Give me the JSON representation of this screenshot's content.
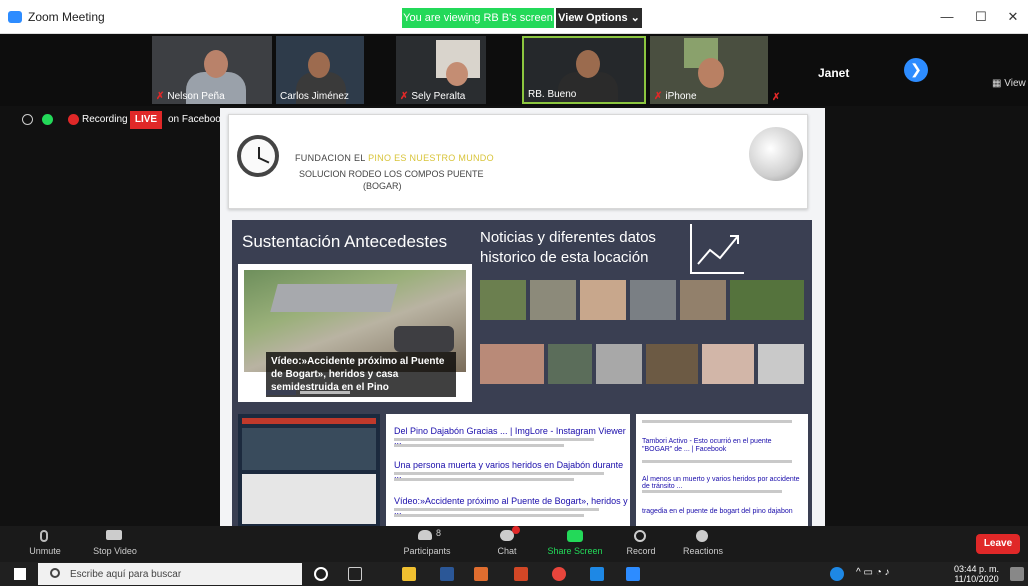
{
  "window": {
    "title": "Zoom Meeting",
    "viewing_banner": "You are viewing RB B's screen",
    "view_options": "View Options ⌄",
    "minimize": "—",
    "maximize": "☐",
    "close": "✕"
  },
  "participants_strip": {
    "tiles": [
      {
        "name": "Nelson Peña",
        "muted": true
      },
      {
        "name": "Carlos Jiménez",
        "muted": false
      },
      {
        "name": "Sely Peralta",
        "muted": true
      },
      {
        "name": "RB. Bueno",
        "muted": false
      },
      {
        "name": "iPhone",
        "muted": true
      }
    ],
    "name_only_tile": "Janet",
    "next_arrow": "❯",
    "view_label": "▦ View",
    "muted_glyph": "✗"
  },
  "status": {
    "recording_label": "Recording",
    "live_label": "LIVE",
    "stream_target": "on Facebook"
  },
  "slide": {
    "org_line1_prefix": "FUNDACION EL ",
    "org_line1_highlight": "PINO ES NUESTRO MUNDO",
    "org_line2": "SOLUCION RODEO LOS COMPOS PUENTE",
    "org_line3": "(BOGAR)",
    "left_title": "Sustentación Antecedestes",
    "right_title": "Noticias y diferentes datos historico de esta locación",
    "news_caption": "Vídeo:»Accidente próximo al Puente de Bogart», heridos y casa semidestruida en el Pino",
    "search_results": [
      {
        "title": "Del Pino Dajabón Gracias ... | ImgLore - Instagram Viewer ..."
      },
      {
        "title": "Una persona muerta y varios heridos en Dajabón durante ..."
      },
      {
        "title": "Vídeo:»Accidente próximo al Puente de Bogart», heridos y ..."
      }
    ],
    "fb_results": [
      {
        "title": "Tambori Activo - Esto ocurrió en el puente \"BOGAR\" de ... | Facebook"
      },
      {
        "title": "Al menos un muerto y varios heridos por accidente de tránsito ..."
      },
      {
        "title": "tragedia en el puente de bogart del pino dajabon"
      }
    ]
  },
  "toolbar": {
    "unmute": "Unmute",
    "stop_video": "Stop Video",
    "participants": "Participants",
    "participants_count": "8",
    "chat": "Chat",
    "share_screen": "Share Screen",
    "record": "Record",
    "reactions": "Reactions",
    "leave": "Leave"
  },
  "taskbar": {
    "search_placeholder": "Escribe aquí para buscar",
    "time": "03:44 p. m.",
    "date": "11/10/2020"
  },
  "colors": {
    "zoom_blue": "#2d8cff",
    "share_green": "#23d959",
    "live_red": "#e02828",
    "slide_panel": "#3a3f52"
  }
}
